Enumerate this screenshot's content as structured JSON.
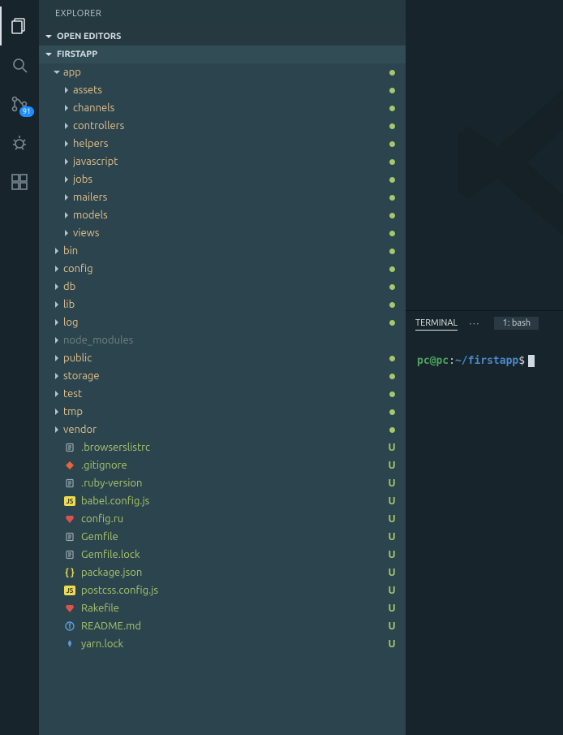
{
  "activity_bar": {
    "scm_badge": "91"
  },
  "sidebar": {
    "title": "EXPLORER",
    "sections": {
      "open_editors": "OPEN EDITORS",
      "project": "FIRSTAPP"
    }
  },
  "tree": [
    {
      "label": "app",
      "type": "folder",
      "expanded": true,
      "depth": 0,
      "git": "modified",
      "status": "dot"
    },
    {
      "label": "assets",
      "type": "folder",
      "expanded": false,
      "depth": 1,
      "git": "modified",
      "status": "dot"
    },
    {
      "label": "channels",
      "type": "folder",
      "expanded": false,
      "depth": 1,
      "git": "modified",
      "status": "dot"
    },
    {
      "label": "controllers",
      "type": "folder",
      "expanded": false,
      "depth": 1,
      "git": "modified",
      "status": "dot"
    },
    {
      "label": "helpers",
      "type": "folder",
      "expanded": false,
      "depth": 1,
      "git": "modified",
      "status": "dot"
    },
    {
      "label": "javascript",
      "type": "folder",
      "expanded": false,
      "depth": 1,
      "git": "modified",
      "status": "dot"
    },
    {
      "label": "jobs",
      "type": "folder",
      "expanded": false,
      "depth": 1,
      "git": "modified",
      "status": "dot"
    },
    {
      "label": "mailers",
      "type": "folder",
      "expanded": false,
      "depth": 1,
      "git": "modified",
      "status": "dot"
    },
    {
      "label": "models",
      "type": "folder",
      "expanded": false,
      "depth": 1,
      "git": "modified",
      "status": "dot"
    },
    {
      "label": "views",
      "type": "folder",
      "expanded": false,
      "depth": 1,
      "git": "modified",
      "status": "dot"
    },
    {
      "label": "bin",
      "type": "folder",
      "expanded": false,
      "depth": 0,
      "git": "modified",
      "status": "dot"
    },
    {
      "label": "config",
      "type": "folder",
      "expanded": false,
      "depth": 0,
      "git": "modified",
      "status": "dot"
    },
    {
      "label": "db",
      "type": "folder",
      "expanded": false,
      "depth": 0,
      "git": "modified",
      "status": "dot"
    },
    {
      "label": "lib",
      "type": "folder",
      "expanded": false,
      "depth": 0,
      "git": "modified",
      "status": "dot"
    },
    {
      "label": "log",
      "type": "folder",
      "expanded": false,
      "depth": 0,
      "git": "modified",
      "status": "dot"
    },
    {
      "label": "node_modules",
      "type": "folder",
      "expanded": false,
      "depth": 0,
      "git": "ignored",
      "status": ""
    },
    {
      "label": "public",
      "type": "folder",
      "expanded": false,
      "depth": 0,
      "git": "modified",
      "status": "dot"
    },
    {
      "label": "storage",
      "type": "folder",
      "expanded": false,
      "depth": 0,
      "git": "modified",
      "status": "dot"
    },
    {
      "label": "test",
      "type": "folder",
      "expanded": false,
      "depth": 0,
      "git": "modified",
      "status": "dot"
    },
    {
      "label": "tmp",
      "type": "folder",
      "expanded": false,
      "depth": 0,
      "git": "modified",
      "status": "dot"
    },
    {
      "label": "vendor",
      "type": "folder",
      "expanded": false,
      "depth": 0,
      "git": "modified",
      "status": "dot"
    },
    {
      "label": ".browserslistrc",
      "type": "file",
      "icon": "text",
      "depth": 0,
      "git": "untracked",
      "status": "U"
    },
    {
      "label": ".gitignore",
      "type": "file",
      "icon": "git",
      "depth": 0,
      "git": "untracked",
      "status": "U"
    },
    {
      "label": ".ruby-version",
      "type": "file",
      "icon": "text",
      "depth": 0,
      "git": "untracked",
      "status": "U"
    },
    {
      "label": "babel.config.js",
      "type": "file",
      "icon": "js",
      "depth": 0,
      "git": "untracked",
      "status": "U"
    },
    {
      "label": "config.ru",
      "type": "file",
      "icon": "ruby",
      "depth": 0,
      "git": "untracked",
      "status": "U"
    },
    {
      "label": "Gemfile",
      "type": "file",
      "icon": "text",
      "depth": 0,
      "git": "untracked",
      "status": "U"
    },
    {
      "label": "Gemfile.lock",
      "type": "file",
      "icon": "text",
      "depth": 0,
      "git": "untracked",
      "status": "U"
    },
    {
      "label": "package.json",
      "type": "file",
      "icon": "json",
      "depth": 0,
      "git": "untracked",
      "status": "U"
    },
    {
      "label": "postcss.config.js",
      "type": "file",
      "icon": "js",
      "depth": 0,
      "git": "untracked",
      "status": "U"
    },
    {
      "label": "Rakefile",
      "type": "file",
      "icon": "ruby",
      "depth": 0,
      "git": "untracked",
      "status": "U"
    },
    {
      "label": "README.md",
      "type": "file",
      "icon": "info",
      "depth": 0,
      "git": "untracked",
      "status": "U"
    },
    {
      "label": "yarn.lock",
      "type": "file",
      "icon": "yarn",
      "depth": 0,
      "git": "untracked",
      "status": "U"
    }
  ],
  "terminal": {
    "tab_label": "TERMINAL",
    "more": "···",
    "selector": "1: bash",
    "prompt": {
      "user": "pc@pc",
      "sep": ":",
      "path": "~/firstapp",
      "dollar": "$"
    }
  }
}
